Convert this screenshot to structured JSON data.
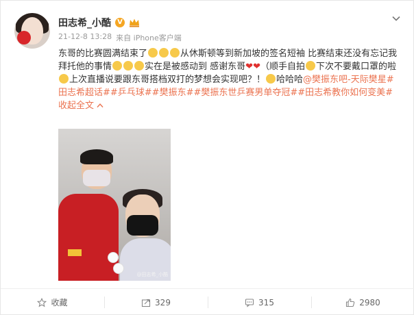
{
  "post": {
    "author_name": "田志希_小酷",
    "verified_badge": "V",
    "timestamp": "21-12-8 13:28",
    "source": "来自 iPhone客户端",
    "text_segments": {
      "p1": "东哥的比赛圆满结束了",
      "p2": "从休斯顿等到新加坡的签名短袖 比赛结束还没有忘记我拜托他的事情",
      "p3": "实在是被感动到 感谢东哥",
      "p4": "（顺手自拍",
      "p5": "下次不要戴口罩的啦",
      "p6": "上次直播说要跟东哥搭档双打的梦想会实现吧？！",
      "p7": "哈哈哈",
      "mention": "@樊振东吧-天际樊星",
      "hashtags": "#田志希超话##乒乓球##樊振东##樊振东世乒赛男单夺冠##田志希教你如何变美#",
      "collapse": "收起全文",
      "collapse_icon": "chevron-up"
    },
    "photo_watermark": "@田志希_小酷"
  },
  "actions": {
    "favorite_label": "收藏",
    "repost_count": "329",
    "comment_count": "315",
    "like_count": "2980"
  },
  "colors": {
    "link": "#eb7350",
    "heart": "#e0312f",
    "verified": "#f5a623"
  }
}
